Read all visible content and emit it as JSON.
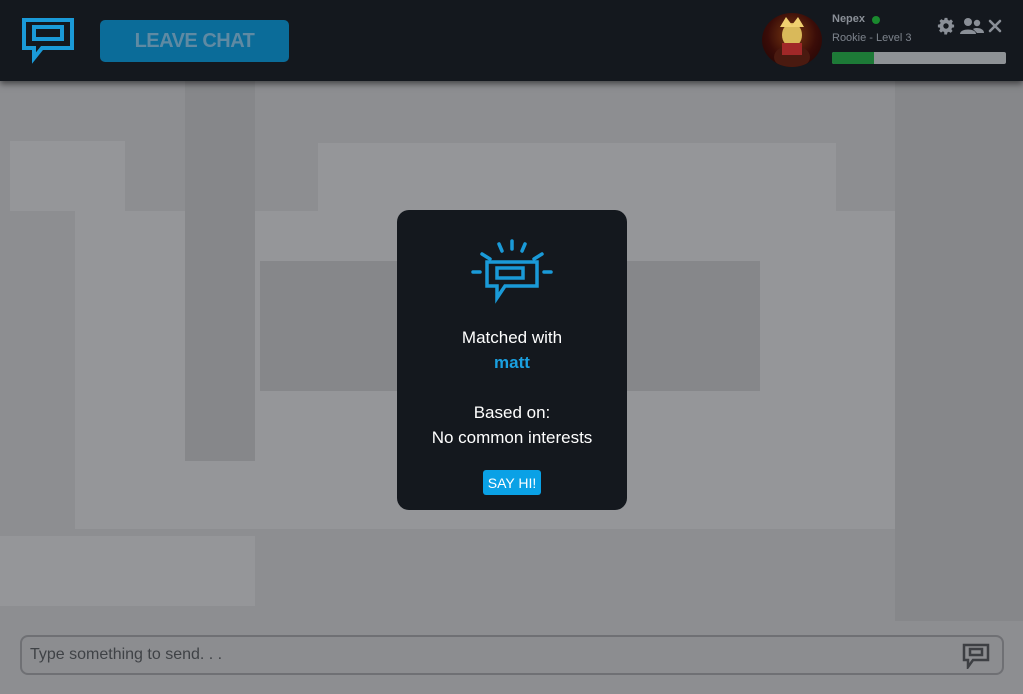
{
  "header": {
    "leave_button_label": "LEAVE CHAT",
    "brand_color": "#1aa0e0",
    "icons": [
      "chat-logo-icon",
      "gear-icon",
      "people-icon",
      "close-icon"
    ]
  },
  "user": {
    "name": "Nepex",
    "status": "online",
    "rank": "Rookie - Level 3",
    "xp_progress": 0.24
  },
  "match_modal": {
    "matched_label": "Matched with",
    "matched_name": "matt",
    "based_label": "Based on:",
    "interests_text": "No common interests",
    "say_hi_label": "SAY HI!"
  },
  "composer": {
    "placeholder": "Type something to send. . .",
    "value": ""
  }
}
